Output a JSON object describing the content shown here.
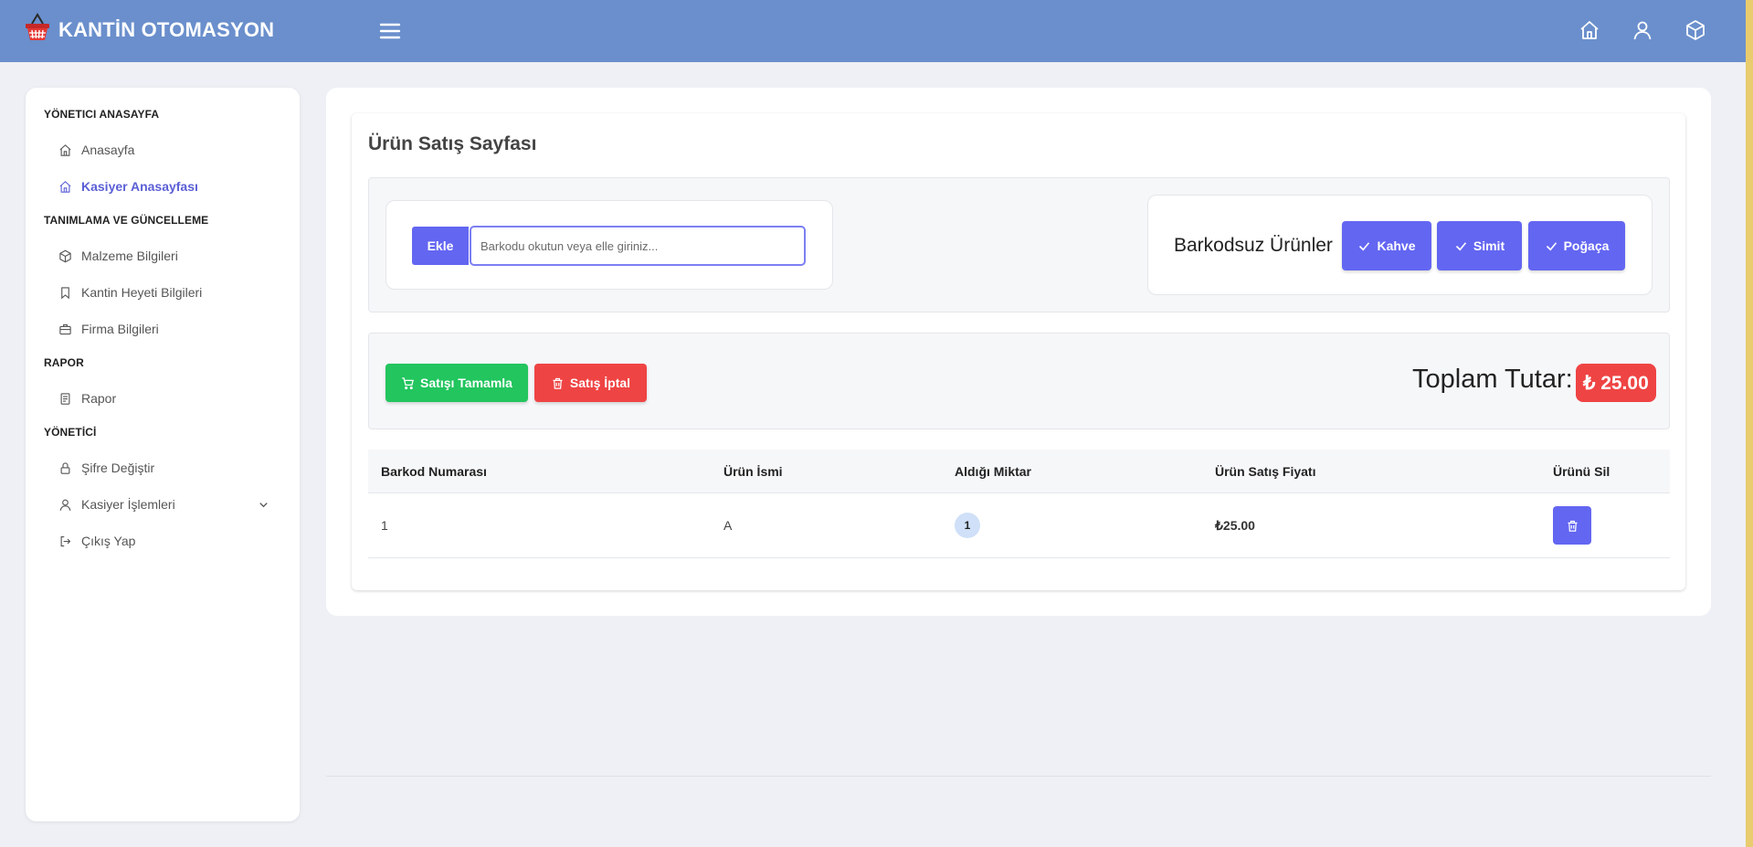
{
  "app": {
    "title": "KANTİN OTOMASYON"
  },
  "colors": {
    "header": "#6a8fcc",
    "primary": "#6366f1",
    "success": "#22c55e",
    "danger": "#ef4444",
    "active_link": "#5b5fd6"
  },
  "header": {
    "icons": [
      "home-icon",
      "user-icon",
      "box-icon"
    ]
  },
  "sidebar": {
    "sections": [
      {
        "title": "YÖNETICI ANASAYFA",
        "items": [
          {
            "label": "Anasayfa",
            "icon": "home-icon"
          },
          {
            "label": "Kasiyer Anasayfası",
            "icon": "home-icon",
            "active": true
          }
        ]
      },
      {
        "title": "TANIMLAMA VE GÜNCELLEME",
        "items": [
          {
            "label": "Malzeme Bilgileri",
            "icon": "box-icon"
          },
          {
            "label": "Kantin Heyeti Bilgileri",
            "icon": "bookmark-icon"
          },
          {
            "label": "Firma Bilgileri",
            "icon": "briefcase-icon"
          }
        ]
      },
      {
        "title": "RAPOR",
        "items": [
          {
            "label": "Rapor",
            "icon": "document-icon"
          }
        ]
      },
      {
        "title": "YÖNETİCİ",
        "items": [
          {
            "label": "Şifre Değiştir",
            "icon": "lock-icon"
          },
          {
            "label": "Kasiyer İşlemleri",
            "icon": "user-icon",
            "has_chevron": true
          },
          {
            "label": "Çıkış Yap",
            "icon": "logout-icon"
          }
        ]
      }
    ]
  },
  "main": {
    "page_title": "Ürün Satış Sayfası",
    "scan": {
      "add_label": "Ekle",
      "placeholder": "Barkodu okutun veya elle giriniz..."
    },
    "no_barcode": {
      "label": "Barkodsuz Ürünler",
      "buttons": [
        "Kahve",
        "Simit",
        "Poğaça"
      ]
    },
    "actions": {
      "complete_label": "Satışı Tamamla",
      "cancel_label": "Satış İptal"
    },
    "total": {
      "label": "Toplam Tutar:",
      "value": "₺ 25.00"
    },
    "table": {
      "headers": [
        "Barkod Numarası",
        "Ürün İsmi",
        "Aldığı Miktar",
        "Ürün Satış Fiyatı",
        "Ürünü Sil"
      ],
      "rows": [
        {
          "barcode": "1",
          "name": "A",
          "qty": "1",
          "price": "₺25.00"
        }
      ]
    }
  }
}
